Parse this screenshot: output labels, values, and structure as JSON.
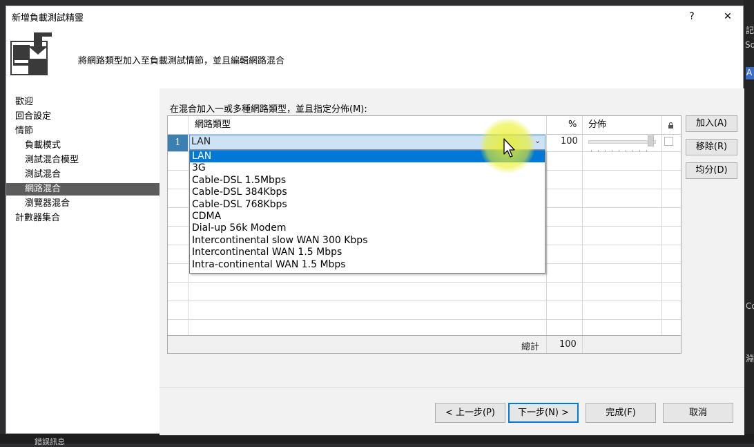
{
  "window": {
    "title": "新增負載測試精靈",
    "help_label": "?",
    "close_label": "✕"
  },
  "header": {
    "text": "將網路類型加入至負載測試情節，並且編輯網路混合"
  },
  "nav": {
    "items": [
      {
        "label": "歡迎",
        "selected": false
      },
      {
        "label": "回合設定",
        "selected": false
      },
      {
        "label": "情節",
        "selected": false
      },
      {
        "label": "負載模式",
        "selected": false
      },
      {
        "label": "測試混合模型",
        "selected": false
      },
      {
        "label": "測試混合",
        "selected": false
      },
      {
        "label": "網路混合",
        "selected": true
      },
      {
        "label": "瀏覽器混合",
        "selected": false
      },
      {
        "label": "計數器集合",
        "selected": false
      }
    ]
  },
  "instruction": "在混合加入一或多種網路類型，並且指定分佈(M):",
  "grid": {
    "headers": {
      "type": "網路類型",
      "percent": "%",
      "distribution": "分佈"
    },
    "row": {
      "number": "1",
      "value": "LAN",
      "percent": "100"
    },
    "total_label": "總計",
    "total_value": "100"
  },
  "dropdown": {
    "options": [
      "LAN",
      "3G",
      "Cable-DSL 1.5Mbps",
      "Cable-DSL 384Kbps",
      "Cable-DSL 768Kbps",
      "CDMA",
      "Dial-up 56k Modem",
      "Intercontinental slow WAN 300 Kbps",
      "Intercontinental WAN 1.5 Mbps",
      "Intra-continental WAN 1.5 Mbps"
    ],
    "selected_index": 0
  },
  "side_buttons": {
    "add": "加入(A)",
    "remove": "移除(R)",
    "distribute": "均分(D)"
  },
  "footer": {
    "previous": "< 上一步(P)",
    "next": "下一步(N) >",
    "finish": "完成(F)",
    "cancel": "取消"
  },
  "background": {
    "right_edge_text": [
      "記",
      "So",
      "A",
      "Co",
      "淵"
    ],
    "bottom_text": "錯誤訊息"
  }
}
